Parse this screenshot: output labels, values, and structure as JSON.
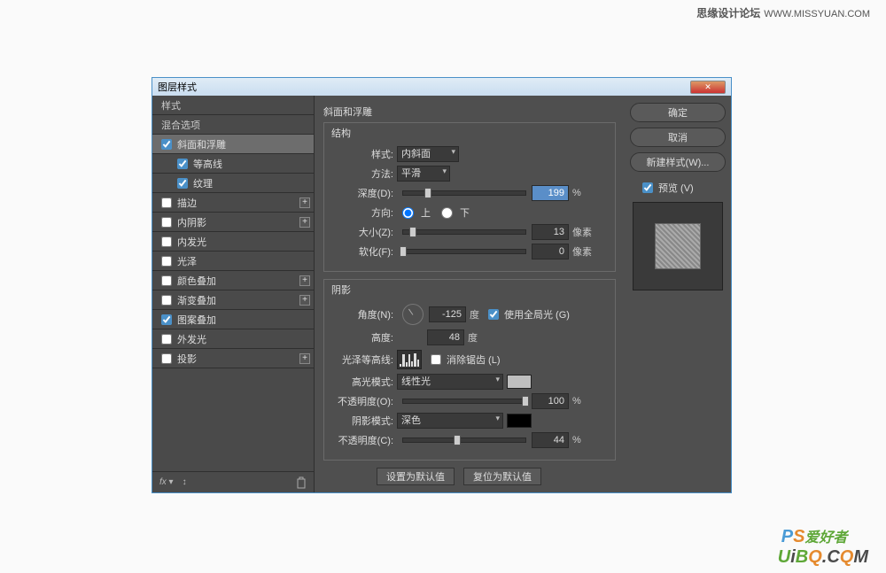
{
  "page": {
    "forum": "思缘设计论坛",
    "site": "WWW.MISSYUAN.COM"
  },
  "dialog": {
    "title": "图层样式",
    "close": "✕"
  },
  "sidebar": {
    "styles": "样式",
    "blending": "混合选项",
    "items": [
      {
        "label": "斜面和浮雕",
        "checked": true,
        "selected": true
      },
      {
        "label": "等高线",
        "checked": true,
        "sub": true
      },
      {
        "label": "纹理",
        "checked": true,
        "sub": true
      },
      {
        "label": "描边",
        "checked": false,
        "plus": true
      },
      {
        "label": "内阴影",
        "checked": false,
        "plus": true
      },
      {
        "label": "内发光",
        "checked": false
      },
      {
        "label": "光泽",
        "checked": false
      },
      {
        "label": "颜色叠加",
        "checked": false,
        "plus": true
      },
      {
        "label": "渐变叠加",
        "checked": false,
        "plus": true
      },
      {
        "label": "图案叠加",
        "checked": true
      },
      {
        "label": "外发光",
        "checked": false
      },
      {
        "label": "投影",
        "checked": false,
        "plus": true
      }
    ],
    "fx": "fx"
  },
  "main": {
    "title": "斜面和浮雕",
    "structure": "结构",
    "style_lbl": "样式:",
    "style_val": "内斜面",
    "technique_lbl": "方法:",
    "technique_val": "平滑",
    "depth_lbl": "深度(D):",
    "depth_val": "199",
    "depth_unit": "%",
    "direction_lbl": "方向:",
    "dir_up": "上",
    "dir_down": "下",
    "size_lbl": "大小(Z):",
    "size_val": "13",
    "size_unit": "像素",
    "soften_lbl": "软化(F):",
    "soften_val": "0",
    "soften_unit": "像素",
    "shading": "阴影",
    "angle_lbl": "角度(N):",
    "angle_val": "-125",
    "angle_unit": "度",
    "global_light": "使用全局光 (G)",
    "altitude_lbl": "高度:",
    "altitude_val": "48",
    "altitude_unit": "度",
    "gloss_lbl": "光泽等高线:",
    "antialias": "消除锯齿 (L)",
    "highlight_mode_lbl": "高光模式:",
    "highlight_mode": "线性光",
    "highlight_opacity_lbl": "不透明度(O):",
    "highlight_opacity": "100",
    "opacity_unit": "%",
    "shadow_mode_lbl": "阴影模式:",
    "shadow_mode": "深色",
    "shadow_opacity_lbl": "不透明度(C):",
    "shadow_opacity": "44",
    "default_set": "设置为默认值",
    "default_reset": "复位为默认值"
  },
  "right": {
    "ok": "确定",
    "cancel": "取消",
    "new_style": "新建样式(W)...",
    "preview": "预览 (V)"
  },
  "colors": {
    "highlight_swatch": "#bfbfbf",
    "shadow_swatch": "#000000"
  },
  "chart_data": {
    "type": "area",
    "title": "光泽等高线",
    "x": [
      0,
      0.2,
      0.35,
      0.5,
      0.65,
      0.8,
      1.0
    ],
    "values": [
      0.1,
      0.9,
      0.2,
      0.85,
      0.3,
      0.95,
      0.4
    ],
    "xlabel": "",
    "ylabel": ""
  }
}
